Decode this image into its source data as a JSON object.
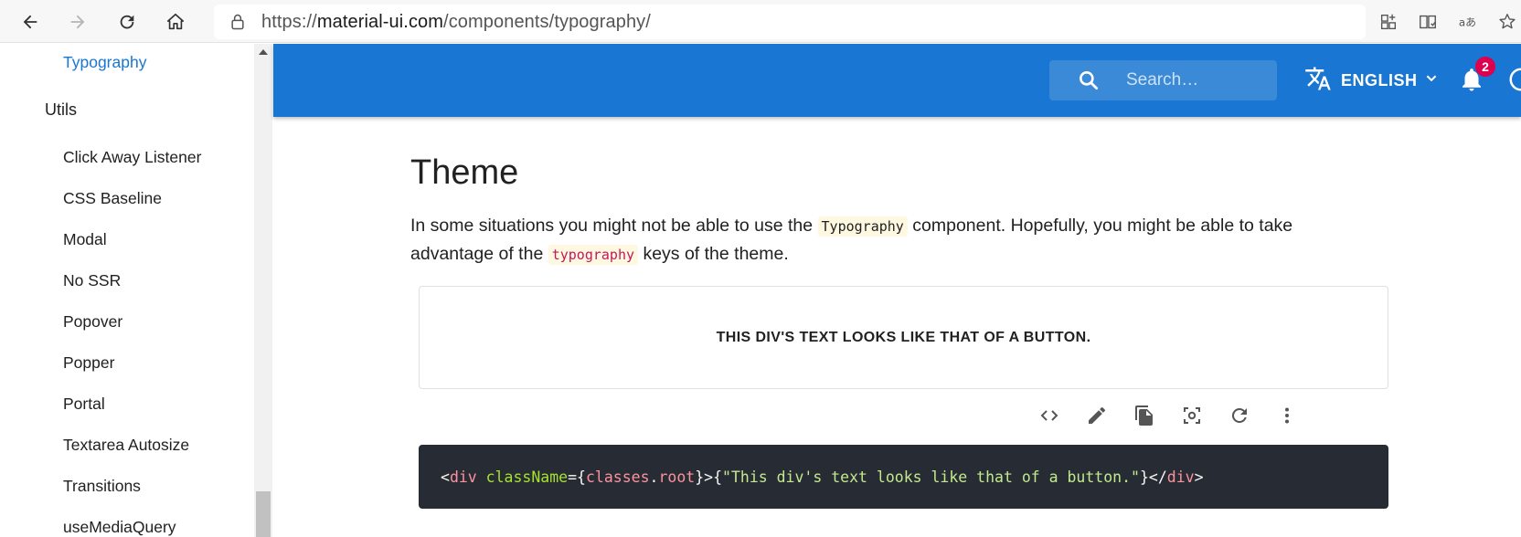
{
  "browser": {
    "url_prefix": "https://",
    "url_host": "material-ui.com",
    "url_path": "/components/typography/",
    "icons": [
      "back-icon",
      "forward-icon",
      "refresh-icon",
      "home-icon",
      "lock-icon",
      "apps-icon",
      "reader-icon",
      "translate-icon",
      "favorites-add-icon"
    ]
  },
  "sidebar": {
    "active_item": "Typography",
    "group": "Utils",
    "items": [
      "Click Away Listener",
      "CSS Baseline",
      "Modal",
      "No SSR",
      "Popover",
      "Popper",
      "Portal",
      "Textarea Autosize",
      "Transitions",
      "useMediaQuery"
    ]
  },
  "appbar": {
    "search_placeholder": "Search…",
    "language": "ENGLISH",
    "notification_count": "2",
    "accent_color": "#1976d2",
    "badge_color": "#dc004e"
  },
  "content": {
    "heading": "Theme",
    "para_part1": "In some situations you might not be able to use the ",
    "para_code1": "Typography",
    "para_part2": " component. Hopefully, you might be able to take advantage of the ",
    "para_code2": "typography",
    "para_part3": " keys of the theme.",
    "demo_text": "THIS DIV'S TEXT LOOKS LIKE THAT OF A BUTTON.",
    "toolbar_icons": [
      "code-icon",
      "edit-icon",
      "copy-icon",
      "screenshot-icon",
      "reset-icon",
      "more-icon"
    ],
    "code": {
      "open_lt": "<",
      "tag": "div",
      "attr": " className",
      "eq_brace": "={",
      "obj": "classes",
      "dot": ".",
      "prop": "root",
      "close_brace_gt_brace": "}>{",
      "string": "\"This div's text looks like that of a button.\"",
      "close_brace_lt_slash": "}</",
      "close_tag": "div",
      "gt": ">"
    }
  }
}
